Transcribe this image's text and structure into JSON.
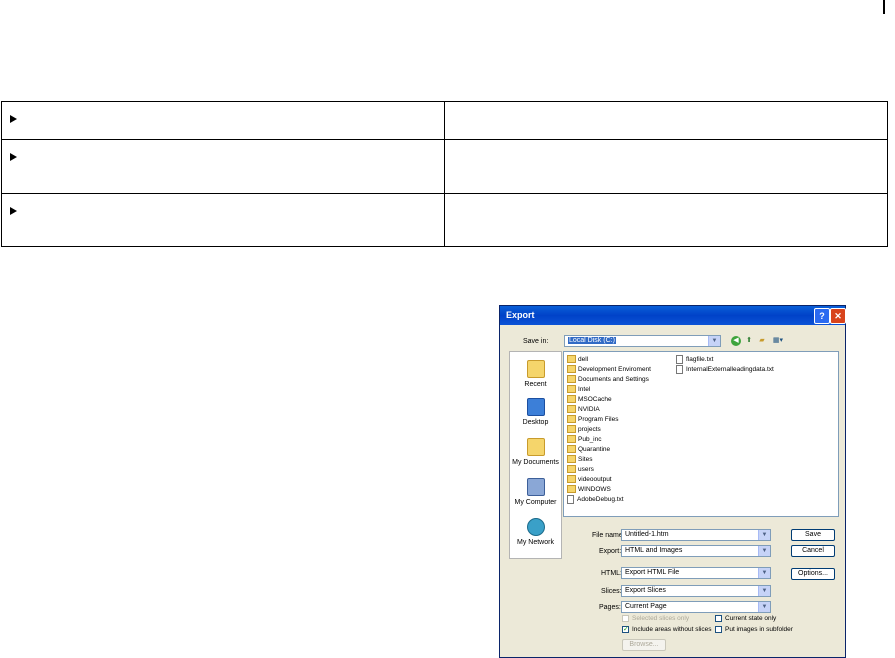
{
  "table": {
    "rows": [
      {
        "left": "",
        "right": ""
      },
      {
        "left": "",
        "right": ""
      },
      {
        "left": "",
        "right": ""
      }
    ]
  },
  "dialog": {
    "title": "Export",
    "help_label": "?",
    "close_label": "✕",
    "save_in_label": "Save in:",
    "save_in_value": "Local Disk (C:)",
    "places": [
      "Recent",
      "Desktop",
      "My Documents",
      "My Computer",
      "My Network"
    ],
    "files_col1": [
      "dell",
      "Development Enviroment",
      "Documents and Settings",
      "Intel",
      "MSOCache",
      "NVIDIA",
      "Program Files",
      "projects",
      "Pub_inc",
      "Quarantine",
      "Sites",
      "users",
      "videooutput",
      "WINDOWS",
      "AdobeDebug.txt"
    ],
    "files_col2": [
      "flagfile.txt",
      "InternalExternalleadingdata.txt"
    ],
    "file_name_label": "File name:",
    "file_name_value": "Untitled-1.htm",
    "export_label": "Export:",
    "export_value": "HTML and Images",
    "html_label": "HTML:",
    "html_value": "Export HTML File",
    "slices_label": "Slices:",
    "slices_value": "Export Slices",
    "pages_label": "Pages:",
    "pages_value": "Current Page",
    "save_button": "Save",
    "cancel_button": "Cancel",
    "options_button": "Options...",
    "browse_button": "Browse...",
    "chk_selected_slices": "Selected slices only",
    "chk_current_state": "Current state only",
    "chk_include_areas": "Include areas without slices",
    "chk_put_images": "Put images in subfolder",
    "include_areas_checked": true,
    "view_menu_icon": "▦▾"
  }
}
